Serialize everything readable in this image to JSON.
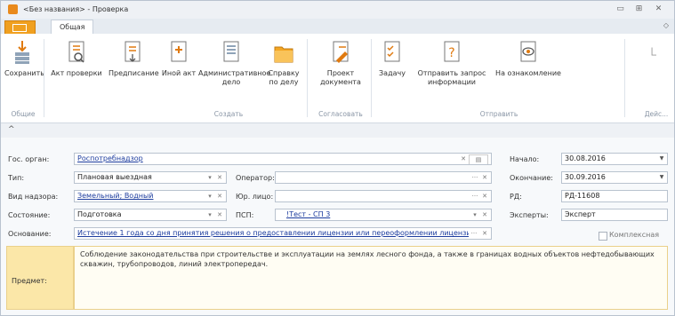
{
  "window": {
    "title": "<Без названия> - Проверка",
    "controls": [
      "▭",
      "⊞",
      "✕"
    ]
  },
  "tabs": {
    "general": "Общая",
    "right_label": "◇"
  },
  "ribbon": {
    "buttons": {
      "save": "Сохранить",
      "act": "Акт проверки",
      "order": "Предписание",
      "other_act": "Иной акт",
      "admin_case_1": "Административное",
      "admin_case_2": "дело",
      "case_ref_1": "Справку",
      "case_ref_2": "по делу",
      "draft_1": "Проект",
      "draft_2": "документа",
      "task": "Задачу",
      "request_1": "Отправить запрос",
      "request_2": "информации",
      "review": "На ознакомление"
    },
    "groups": {
      "common": "Общие",
      "create": "Создать",
      "approve": "Согласовать",
      "send": "Отправить",
      "actions": "Дейс..."
    }
  },
  "collapse_glyph": "^",
  "form": {
    "gos_organ_label": "Гос. орган:",
    "gos_organ_value": "Роспотребнадзор",
    "type_label": "Тип:",
    "type_value": "Плановая выездная",
    "operator_label": "Оператор:",
    "operator_value": "",
    "nadzor_label": "Вид надзора:",
    "nadzor_value": "Земельный; Водный",
    "legal_label": "Юр. лицо:",
    "legal_value": "",
    "state_label": "Состояние:",
    "state_value": "Подготовка",
    "psp_label": "ПСП:",
    "psp_value": "!Тест - СП 3",
    "basis_label": "Основание:",
    "basis_value": "Истечение 1 года со дня принятия решения о предоставлении лицензии или переоформлении лицензии",
    "start_label": "Начало:",
    "start_value": "30.08.2016",
    "end_label": "Окончание:",
    "end_value": "30.09.2016",
    "rd_label": "РД:",
    "rd_value": "РД-11608",
    "experts_label": "Эксперты:",
    "experts_value": "Эксперт",
    "complex_label": "Комплексная",
    "subject_label": "Предмет:",
    "subject_value": "Соблюдение законодательства при строительстве и эксплуатации на землях лесного фонда, а также в границах водных объектов нефтедобывающих скважин, трубопроводов, линий электропередач."
  }
}
